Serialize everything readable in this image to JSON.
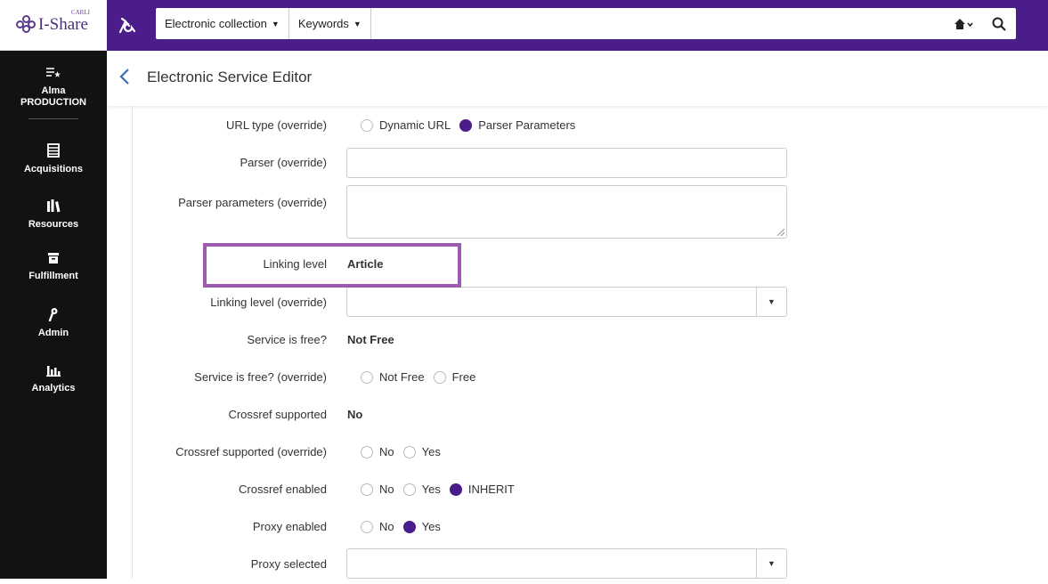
{
  "logo": {
    "text": "I-Share",
    "sup": "CARLI"
  },
  "search": {
    "scope": "Electronic collection",
    "field": "Keywords",
    "value": "",
    "home_icon": "home-icon",
    "search_icon": "search-icon"
  },
  "nav": [
    {
      "label": "Alma PRODUCTION",
      "icon": "alma-star-icon"
    },
    {
      "label": "Acquisitions",
      "icon": "acquisitions-icon"
    },
    {
      "label": "Resources",
      "icon": "resources-icon"
    },
    {
      "label": "Fulfillment",
      "icon": "fulfillment-icon"
    },
    {
      "label": "Admin",
      "icon": "admin-icon"
    },
    {
      "label": "Analytics",
      "icon": "analytics-icon"
    }
  ],
  "page": {
    "title": "Electronic Service Editor"
  },
  "form": {
    "url_type": {
      "label": "URL type (override)",
      "options": [
        "Dynamic URL",
        "Parser Parameters"
      ],
      "selected": "Parser Parameters"
    },
    "parser": {
      "label": "Parser (override)",
      "value": ""
    },
    "parser_params": {
      "label": "Parser parameters (override)",
      "value": ""
    },
    "linking_level": {
      "label": "Linking level",
      "value": "Article"
    },
    "linking_level_override": {
      "label": "Linking level (override)",
      "value": ""
    },
    "service_free": {
      "label": "Service is free?",
      "value": "Not Free"
    },
    "service_free_override": {
      "label": "Service is free? (override)",
      "options": [
        "Not Free",
        "Free"
      ],
      "selected": ""
    },
    "crossref_supported": {
      "label": "Crossref supported",
      "value": "No"
    },
    "crossref_supported_override": {
      "label": "Crossref supported (override)",
      "options": [
        "No",
        "Yes"
      ],
      "selected": ""
    },
    "crossref_enabled": {
      "label": "Crossref enabled",
      "options": [
        "No",
        "Yes",
        "INHERIT"
      ],
      "selected": "INHERIT"
    },
    "proxy_enabled": {
      "label": "Proxy enabled",
      "options": [
        "No",
        "Yes"
      ],
      "selected": "Yes"
    },
    "proxy_selected": {
      "label": "Proxy selected",
      "value": ""
    }
  },
  "colors": {
    "topbar": "#4a1d8a",
    "nav": "#121212",
    "accent": "#4a1d8a",
    "highlight": "#9c5bb0",
    "back": "#3a6fb8"
  }
}
